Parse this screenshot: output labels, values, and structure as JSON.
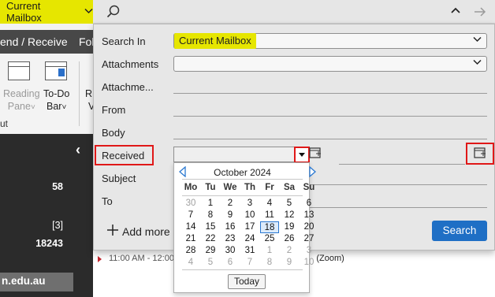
{
  "search_bar": {
    "scope_label": "Current Mailbox",
    "scope_icon": "chevron-down-icon",
    "glass_icon": "search-icon",
    "up_icon": "chevron-up-icon",
    "go_icon": "arrow-right-icon",
    "highlight_color": "#e6e600"
  },
  "ribbon": {
    "tab_send_receive": "end / Receive",
    "tab_folder": "Fol",
    "reading_pane_line1": "Reading",
    "reading_pane_line2": "Pane",
    "todo_bar_line1": "To-Do",
    "todo_bar_line2": "Bar",
    "chev": "˅",
    "partial_letter_1": "R",
    "partial_letter_2": "V",
    "group_footer": "ut"
  },
  "nav": {
    "collapse_icon": "‹",
    "counts": [
      "58",
      "[3]",
      "18243"
    ],
    "domain_item": "n.edu.au"
  },
  "search_panel": {
    "fields": {
      "search_in": {
        "label": "Search In",
        "value": "Current Mailbox"
      },
      "attachments": {
        "label": "Attachments",
        "value": ""
      },
      "attachment_name": {
        "label": "Attachme...",
        "value": ""
      },
      "from": {
        "label": "From",
        "value": ""
      },
      "body": {
        "label": "Body",
        "value": ""
      },
      "received": {
        "label": "Received",
        "value": ""
      },
      "subject": {
        "label": "Subject",
        "value": ""
      },
      "to": {
        "label": "To",
        "value": ""
      }
    },
    "add_more_label": "Add more",
    "search_button": "Search",
    "accent_color": "#1f6fc5",
    "annotation_color": "#e01818"
  },
  "background": {
    "row_text": "11:00 AM - 12:00 P",
    "row_suffix": "(Zoom)"
  },
  "calendar": {
    "month_label": "October 2024",
    "prev_icon": "triangle-left-icon",
    "next_icon": "triangle-right-icon",
    "weekdays": [
      "Mo",
      "Tu",
      "We",
      "Th",
      "Fr",
      "Sa",
      "Su"
    ],
    "weeks": [
      [
        "30",
        "1",
        "2",
        "3",
        "4",
        "5",
        "6"
      ],
      [
        "7",
        "8",
        "9",
        "10",
        "11",
        "12",
        "13"
      ],
      [
        "14",
        "15",
        "16",
        "17",
        "18",
        "19",
        "20"
      ],
      [
        "21",
        "22",
        "23",
        "24",
        "25",
        "26",
        "27"
      ],
      [
        "28",
        "29",
        "30",
        "31",
        "1",
        "2",
        "3"
      ],
      [
        "4",
        "5",
        "6",
        "7",
        "8",
        "9",
        "10"
      ]
    ],
    "selected_day": "18",
    "today_button": "Today"
  }
}
